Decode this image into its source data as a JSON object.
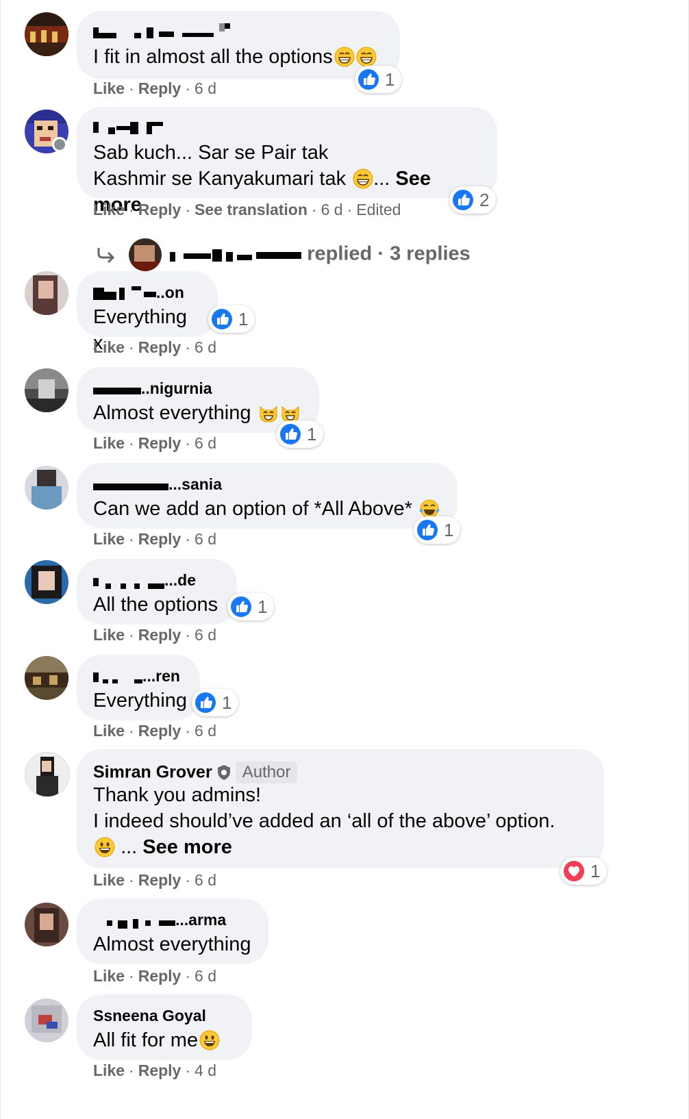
{
  "actions": {
    "like": "Like",
    "reply": "Reply",
    "see_translation": "See translation",
    "sep": "·",
    "edited": "Edited"
  },
  "see_more": "See more",
  "ellipsis": "...",
  "colors": {
    "bubble": "#f0f2f5",
    "meta": "#65676b",
    "like_blue": "#1877f2",
    "love_red": "#f33e58"
  },
  "comments": [
    {
      "text": "I fit in almost all the options",
      "reactions": "1",
      "time": "6 d",
      "emoji": [
        "grin",
        "grin"
      ]
    },
    {
      "line1": "Sab kuch... Sar se Pair tak",
      "line2": "Kashmir se Kanyakumari tak",
      "reactions": "2",
      "time": "6 d",
      "emoji": [
        "grin"
      ]
    },
    {
      "author_tail": "..on",
      "text": "Everything x",
      "reactions": "1",
      "time": "6 d"
    },
    {
      "author_tail": "..nigurnia",
      "text": "Almost everything",
      "reactions": "1",
      "time": "6 d",
      "emoji": [
        "cat-grin",
        "cat-grin"
      ]
    },
    {
      "author_tail": "...sania",
      "text": "Can we add an option of *All Above*",
      "reactions": "1",
      "time": "6 d",
      "emoji": [
        "tears-of-joy"
      ]
    },
    {
      "author_tail": "...de",
      "text": "All the options",
      "reactions": "1",
      "time": "6 d"
    },
    {
      "author_tail": "...ren",
      "text": "Everything",
      "reactions": "1",
      "time": "6 d"
    },
    {
      "author": "Simran Grover",
      "badge": "Author",
      "line1": "Thank you admins!",
      "line2": "I indeed should’ve added an ‘all of the above’ option.",
      "reactions": "1",
      "time": "6 d",
      "reaction_type": "love",
      "emoji": [
        "grinning"
      ]
    },
    {
      "author_tail": "...arma",
      "text": "Almost everything",
      "time": "6 d"
    },
    {
      "author_tail": "Ssneena Goyal",
      "text": "All fit for me",
      "time": "4 d",
      "emoji": [
        "grinning"
      ]
    }
  ],
  "replies_summary": {
    "text": "replied",
    "count": "3 replies"
  }
}
